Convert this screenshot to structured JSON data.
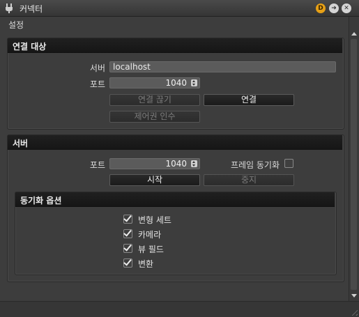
{
  "window": {
    "title": "커넥터",
    "buttons": {
      "d_label": "D",
      "arrow_label": "➜",
      "close_label": "✕"
    }
  },
  "menu": {
    "settings_label": "설정"
  },
  "connect_section": {
    "title": "연결 대상",
    "server_label": "서버",
    "server_value": "localhost",
    "port_label": "포트",
    "port_value": "1040",
    "disconnect_label": "연결 끊기",
    "connect_label": "연결",
    "take_control_label": "제어권 인수"
  },
  "server_section": {
    "title": "서버",
    "port_label": "포트",
    "port_value": "1040",
    "frame_sync_label": "프레임 동기화",
    "frame_sync_checked": false,
    "start_label": "시작",
    "stop_label": "중지"
  },
  "sync_options": {
    "title": "동기화 옵션",
    "items": [
      {
        "label": "변형 세트",
        "checked": true
      },
      {
        "label": "카메라",
        "checked": true
      },
      {
        "label": "뷰 필드",
        "checked": true
      },
      {
        "label": "변환",
        "checked": true
      }
    ]
  },
  "colors": {
    "accent_d": "#e6a016",
    "header_bg": "#1b1b1b",
    "panel_bg": "#3d3d3d"
  }
}
